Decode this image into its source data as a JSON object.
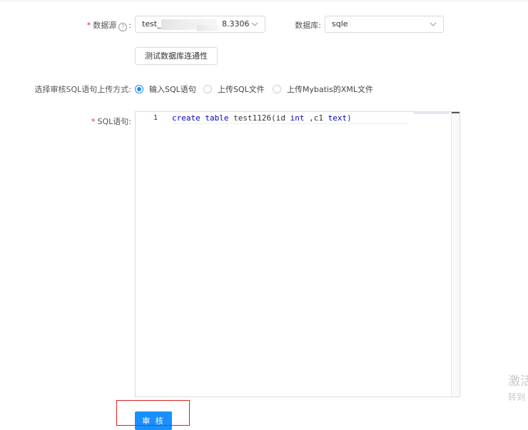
{
  "form": {
    "datasource": {
      "label": "数据源",
      "help_icon": "question-circle-icon",
      "value_prefix": "test_",
      "value_suffix": "8.3306"
    },
    "database": {
      "label": "数据库:",
      "value": "sqle"
    },
    "test_button_label": "测试数据库连通性",
    "upload_mode": {
      "label": "选择审核SQL语句上传方式:",
      "options": [
        {
          "label": "输入SQL语句",
          "selected": true
        },
        {
          "label": "上传SQL文件",
          "selected": false
        },
        {
          "label": "上传Mybatis的XML文件",
          "selected": false
        }
      ]
    },
    "sql": {
      "label": "SQL语句:",
      "line_number": "1",
      "tokens": {
        "t1": "create",
        "t2": "table",
        "t3": "test1126(id",
        "t4": "int",
        "t5": ",c1",
        "t6": "text",
        "t7": ")"
      }
    },
    "audit_button_label": "审 核"
  },
  "watermark": {
    "line1": "激活",
    "line2": "转到"
  },
  "colors": {
    "primary": "#1890ff",
    "required": "#f5222d",
    "highlight": "#e02020",
    "keyword": "#0000cc"
  }
}
